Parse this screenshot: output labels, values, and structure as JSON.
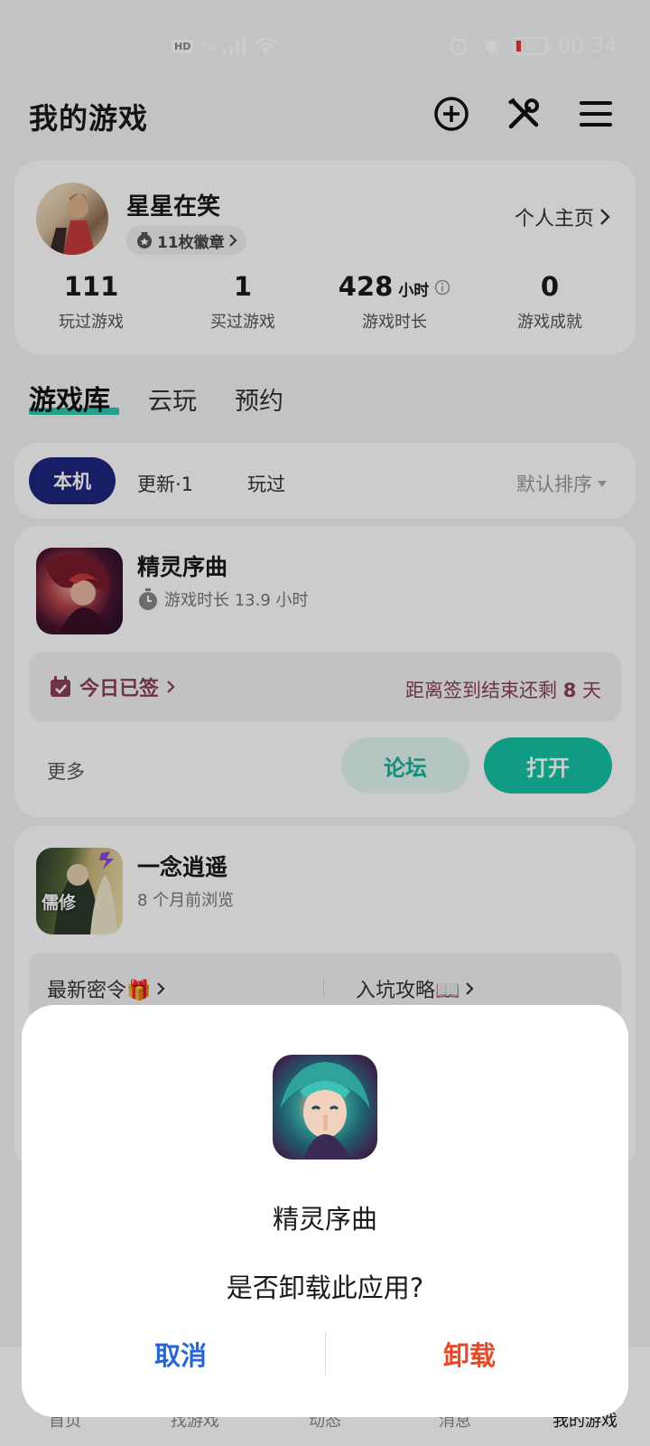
{
  "status_bar": {
    "hd": "HD",
    "network": "5G",
    "time": "00:34",
    "battery": "6"
  },
  "header": {
    "title": "我的游戏",
    "icons": [
      "add-circle-icon",
      "tools-icon",
      "menu-icon"
    ]
  },
  "profile": {
    "username": "星星在笑",
    "badges": "11枚徽章",
    "homepage": "个人主页",
    "stats": [
      {
        "value": "111",
        "unit": "",
        "label": "玩过游戏"
      },
      {
        "value": "1",
        "unit": "",
        "label": "买过游戏"
      },
      {
        "value": "428",
        "unit": "小时",
        "label": "游戏时长"
      },
      {
        "value": "0",
        "unit": "",
        "label": "游戏成就"
      }
    ]
  },
  "tabs": [
    "游戏库",
    "云玩",
    "预约"
  ],
  "filters": {
    "active": "本机",
    "update": "更新·1",
    "played": "玩过",
    "sort": "默认排序"
  },
  "games": [
    {
      "name": "精灵序曲",
      "sub": "游戏时长 13.9 小时",
      "checkin_status": "今日已签",
      "checkin_remaining_prefix": "距离签到结束还剩",
      "checkin_remaining_days": "8",
      "checkin_remaining_suffix": "天",
      "more": "更多",
      "forum_button": "论坛",
      "open_button": "打开"
    },
    {
      "name": "一念逍遥",
      "sub": "8 个月前浏览",
      "icon_text": "儒修",
      "link_left": "最新密令🎁",
      "link_right": "入坑攻略📖"
    }
  ],
  "bottom_nav": [
    "首页",
    "找游戏",
    "动态",
    "消息",
    "我的游戏"
  ],
  "dialog": {
    "app_name": "精灵序曲",
    "message": "是否卸载此应用?",
    "cancel": "取消",
    "confirm": "卸载"
  },
  "colors": {
    "accent": "#14c4a6",
    "chip_active": "#1f2680",
    "cancel": "#2866d8",
    "uninstall": "#e4492a",
    "checkin": "#8a3f58"
  }
}
